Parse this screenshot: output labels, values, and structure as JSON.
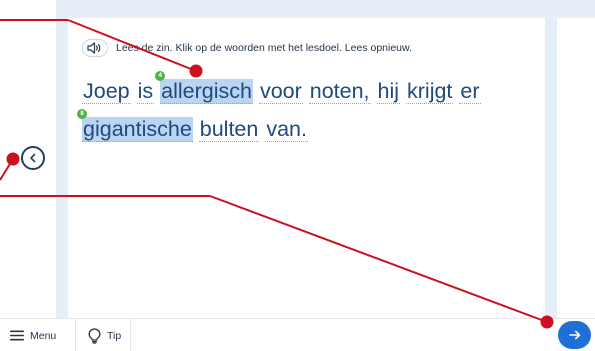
{
  "instruction": {
    "text": "Lees de zin. Klik op de woorden met het lesdoel. Lees opnieuw.",
    "audio_icon": "speaker-icon"
  },
  "sentence": {
    "w1": "Joep",
    "w2": "is",
    "w3": "allergisch",
    "w3_badge": "4",
    "w4": "voor",
    "w5": "noten,",
    "w6": "hij",
    "w7": "krijgt",
    "w8": "er",
    "w9": "gigantische",
    "w9_badge": "8",
    "w10": "bulten",
    "w11": "van."
  },
  "bottombar": {
    "menu_label": "Menu",
    "menu_icon": "hamburger-icon",
    "tip_label": "Tip",
    "tip_icon": "lightbulb-icon"
  },
  "nav": {
    "back_icon": "chevron-left-icon",
    "next_icon": "arrow-right-icon"
  },
  "colors": {
    "highlight": "#b9d5f2",
    "badge": "#4fb248",
    "text_blue": "#1f4a80",
    "next_button": "#1e6fd6",
    "annotation_red": "#cc1020",
    "panel_band": "#e6eef8"
  }
}
